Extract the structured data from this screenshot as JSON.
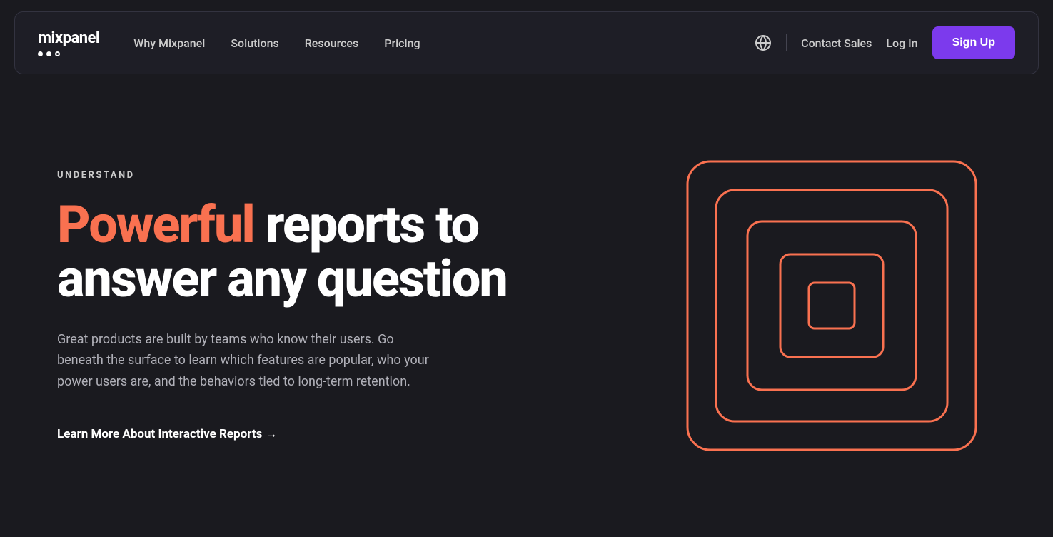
{
  "nav": {
    "logo_text": "mixpanel",
    "logo_dots_count": 3,
    "links": [
      {
        "label": "Why Mixpanel",
        "id": "why-mixpanel"
      },
      {
        "label": "Solutions",
        "id": "solutions"
      },
      {
        "label": "Resources",
        "id": "resources"
      },
      {
        "label": "Pricing",
        "id": "pricing"
      }
    ],
    "contact_sales": "Contact Sales",
    "login": "Log In",
    "signup": "Sign Up"
  },
  "hero": {
    "eyebrow": "UNDERSTAND",
    "headline_accent": "Powerful",
    "headline_rest": " reports to answer any question",
    "description": "Great products are built by teams who know their users. Go beneath the surface to learn which features are popular, who your power users are, and the behaviors tied to long-term retention.",
    "cta_label": "Learn More About Interactive Reports →"
  },
  "colors": {
    "accent": "#f97150",
    "purple": "#7c3aed",
    "background": "#1a1a1f",
    "nav_bg": "#1e1e26"
  }
}
